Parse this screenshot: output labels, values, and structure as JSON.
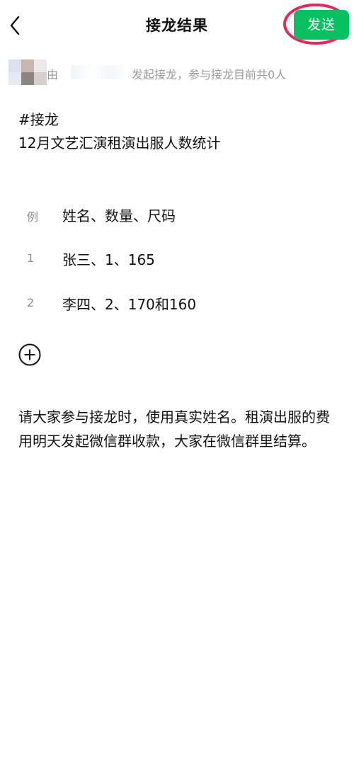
{
  "header": {
    "back_icon": "chevron-left-icon",
    "title": "接龙结果",
    "send_label": "发送",
    "accent": "#07c160",
    "highlight": "#e8265a"
  },
  "info": {
    "by_label": "由",
    "text": "发起接龙，参与接龙目前共0人"
  },
  "topic": {
    "hashtag": "#接龙",
    "subject": "12月文艺汇演租演出服人数统计"
  },
  "entries": [
    {
      "index": "例",
      "text": "姓名、数量、尺码"
    },
    {
      "index": "1",
      "text": "张三、1、165"
    },
    {
      "index": "2",
      "text": "李四、2、170和160"
    }
  ],
  "add_icon": "plus-circle-icon",
  "note": "请大家参与接龙时，使用真实姓名。租演出服的费用明天发起微信群收款，大家在微信群里结算。"
}
